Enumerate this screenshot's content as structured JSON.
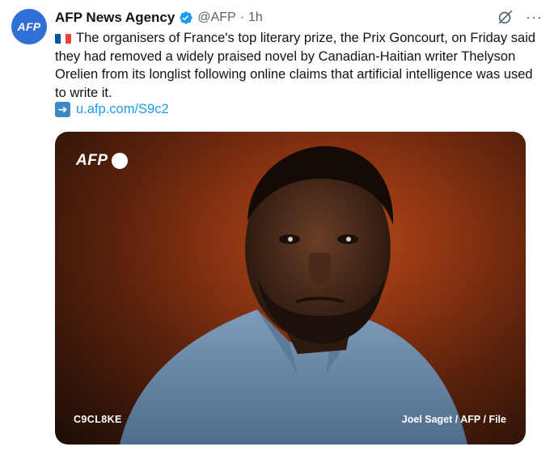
{
  "account": {
    "avatar_text": "AFP",
    "name": "AFP News Agency",
    "handle": "@AFP",
    "separator": "·",
    "time": "1h",
    "verified_color": "#1d9bf0"
  },
  "actions": {
    "grok_icon": "grok-icon",
    "more_label": "···"
  },
  "tweet": {
    "flag": "france-flag",
    "text": "The organisers of France's top literary prize, the Prix Goncourt, on Friday said they had removed a widely praised novel by Canadian-Haitian writer Thelyson Orelien from its longlist following online claims that artificial intelligence was used to write it.",
    "link_icon": "right-arrow-icon",
    "link": "u.afp.com/S9c2"
  },
  "media": {
    "logo_text": "AFP",
    "photo_code": "C9CL8KE",
    "credit": "Joel Saget / AFP / File"
  },
  "colors": {
    "link": "#1d9bf0",
    "secondary_text": "#536471",
    "avatar_bg": "#2f6fd6"
  }
}
